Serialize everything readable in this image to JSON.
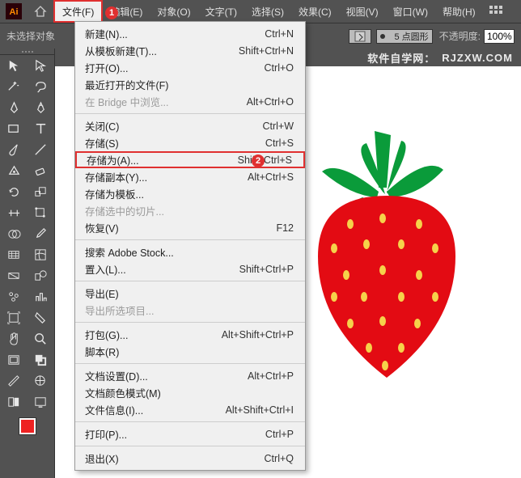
{
  "menubar": {
    "items": [
      "文件(F)",
      "编辑(E)",
      "对象(O)",
      "文字(T)",
      "选择(S)",
      "效果(C)",
      "视图(V)",
      "窗口(W)",
      "帮助(H)"
    ]
  },
  "optbar": {
    "noSelection": "未选择对象",
    "strokeLabel": "5 点圆形",
    "opacityLabel": "不透明度:",
    "opacityValue": "100%"
  },
  "brand": {
    "cn": "软件自学网：",
    "en": "RJZXW.COM"
  },
  "badges": {
    "b1": "1",
    "b2": "2"
  },
  "menu": {
    "g1": [
      {
        "label": "新建(N)...",
        "sc": "Ctrl+N"
      },
      {
        "label": "从模板新建(T)...",
        "sc": "Shift+Ctrl+N"
      },
      {
        "label": "打开(O)...",
        "sc": "Ctrl+O"
      },
      {
        "label": "最近打开的文件(F)",
        "sc": ""
      },
      {
        "label": "在 Bridge 中浏览...",
        "sc": "Alt+Ctrl+O",
        "disabled": true
      }
    ],
    "g2": [
      {
        "label": "关闭(C)",
        "sc": "Ctrl+W"
      },
      {
        "label": "存储(S)",
        "sc": "Ctrl+S"
      },
      {
        "label": "存储为(A)...",
        "sc": "Shift+Ctrl+S",
        "hl": true
      },
      {
        "label": "存储副本(Y)...",
        "sc": "Alt+Ctrl+S"
      },
      {
        "label": "存储为模板...",
        "sc": ""
      },
      {
        "label": "存储选中的切片...",
        "sc": "",
        "disabled": true
      },
      {
        "label": "恢复(V)",
        "sc": "F12"
      }
    ],
    "g3": [
      {
        "label": "搜索 Adobe Stock...",
        "sc": ""
      },
      {
        "label": "置入(L)...",
        "sc": "Shift+Ctrl+P"
      }
    ],
    "g4": [
      {
        "label": "导出(E)",
        "sc": ""
      },
      {
        "label": "导出所选项目...",
        "sc": "",
        "disabled": true
      }
    ],
    "g5": [
      {
        "label": "打包(G)...",
        "sc": "Alt+Shift+Ctrl+P"
      },
      {
        "label": "脚本(R)",
        "sc": ""
      }
    ],
    "g6": [
      {
        "label": "文档设置(D)...",
        "sc": "Alt+Ctrl+P"
      },
      {
        "label": "文档颜色模式(M)",
        "sc": ""
      },
      {
        "label": "文件信息(I)...",
        "sc": "Alt+Shift+Ctrl+I"
      }
    ],
    "g7": [
      {
        "label": "打印(P)...",
        "sc": "Ctrl+P"
      }
    ],
    "g8": [
      {
        "label": "退出(X)",
        "sc": "Ctrl+Q"
      }
    ]
  }
}
